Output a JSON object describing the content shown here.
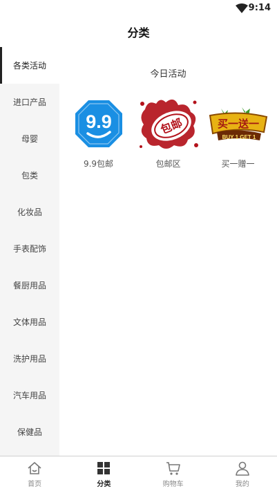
{
  "status_bar": {
    "time": "9:14",
    "wifi_icon": "wifi-icon"
  },
  "header": {
    "title": "分类"
  },
  "sidebar": {
    "items": [
      {
        "label": "各类活动",
        "active": true
      },
      {
        "label": "进口产品",
        "active": false
      },
      {
        "label": "母婴",
        "active": false
      },
      {
        "label": "包类",
        "active": false
      },
      {
        "label": "化妆品",
        "active": false
      },
      {
        "label": "手表配饰",
        "active": false
      },
      {
        "label": "餐厨用品",
        "active": false
      },
      {
        "label": "文体用品",
        "active": false
      },
      {
        "label": "洗护用品",
        "active": false
      },
      {
        "label": "汽车用品",
        "active": false
      },
      {
        "label": "保健品",
        "active": false
      }
    ]
  },
  "main": {
    "section_title": "今日活动",
    "activities": [
      {
        "label": "9.9包邮",
        "icon": "nine-nine-badge-icon",
        "badge_text": "9.9",
        "color": "#1a8fe3"
      },
      {
        "label": "包邮区",
        "icon": "free-shipping-stamp-icon",
        "badge_text": "包邮",
        "color": "#b3121b"
      },
      {
        "label": "买一赠一",
        "icon": "buy-one-get-one-icon",
        "badge_text": "买一送一",
        "badge_subtext": "BUY 1 GET 1",
        "color": "#e8b214"
      }
    ]
  },
  "tabbar": {
    "tabs": [
      {
        "label": "首页",
        "icon": "home-icon",
        "active": false
      },
      {
        "label": "分类",
        "icon": "category-grid-icon",
        "active": true
      },
      {
        "label": "购物车",
        "icon": "shopping-cart-icon",
        "active": false
      },
      {
        "label": "我的",
        "icon": "user-icon",
        "active": false
      }
    ]
  }
}
